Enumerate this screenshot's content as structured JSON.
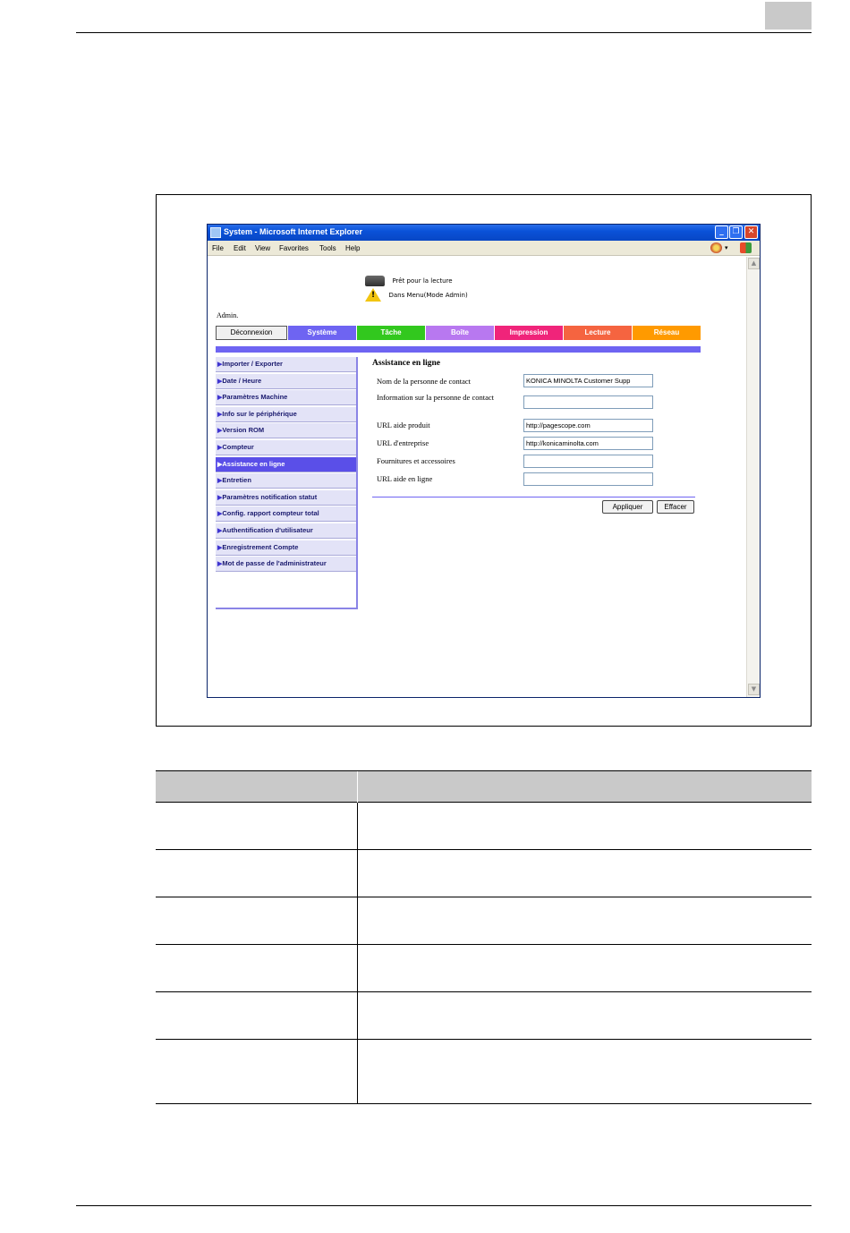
{
  "window": {
    "title": "System - Microsoft Internet Explorer",
    "controls": {
      "minimize": "_",
      "maximize": "❐",
      "close": "✕"
    },
    "menu": [
      "File",
      "Edit",
      "View",
      "Favorites",
      "Tools",
      "Help"
    ]
  },
  "status": {
    "ready": "Prêt pour la lecture",
    "mode": "Dans Menu(Mode Admin)"
  },
  "user": {
    "label": "Admin."
  },
  "nav": {
    "logout": "Déconnexion",
    "tabs": [
      "Système",
      "Tâche",
      "Boîte",
      "Impression",
      "Lecture",
      "Réseau"
    ]
  },
  "sidebar": {
    "items": [
      "Importer / Exporter",
      "Date / Heure",
      "Paramètres Machine",
      "Info sur le périphérique",
      "Version ROM",
      "Compteur",
      "Assistance en ligne",
      "Entretien",
      "Paramètres notification statut",
      "Config. rapport compteur total",
      "Authentification d'utilisateur",
      "Enregistrement Compte",
      "Mot de passe de l'administrateur"
    ],
    "active_index": 6
  },
  "form": {
    "title": "Assistance en ligne",
    "fields": [
      {
        "label": "Nom de la personne de contact",
        "value": "KONICA MINOLTA Customer Supp"
      },
      {
        "label": "Information sur la personne de contact",
        "value": ""
      },
      {
        "label": "URL aide produit",
        "value": "http://pagescope.com"
      },
      {
        "label": "URL d'entreprise",
        "value": "http://konicaminolta.com"
      },
      {
        "label": "Fournitures et accessoires",
        "value": ""
      },
      {
        "label": "URL aide en ligne",
        "value": ""
      }
    ],
    "apply": "Appliquer",
    "clear": "Effacer"
  },
  "colors": {
    "systeme": "#6e64f2",
    "tache": "#32c81e",
    "boite": "#b878f0",
    "impression": "#f0247a",
    "lecture": "#f56440",
    "reseau": "#ff9a00"
  }
}
